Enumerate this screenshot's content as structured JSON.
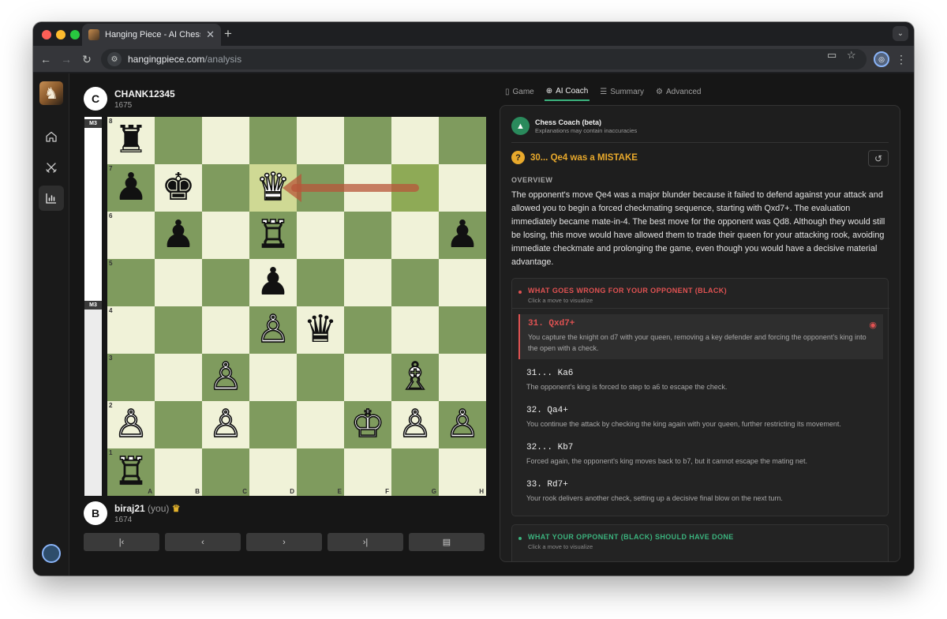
{
  "browser": {
    "tab_title": "Hanging Piece - AI Chess Coach",
    "url_host": "hangingpiece.com",
    "url_path": "/analysis"
  },
  "players": {
    "top": {
      "initial": "C",
      "name": "CHANK12345",
      "rating": "1675"
    },
    "bottom": {
      "initial": "B",
      "name": "biraj21",
      "you_label": "(you)",
      "rating": "1674"
    }
  },
  "eval_badges": {
    "top": "M3",
    "mid": "M3"
  },
  "board": {
    "ranks": [
      "8",
      "7",
      "6",
      "5",
      "4",
      "3",
      "2",
      "1"
    ],
    "files": [
      "A",
      "B",
      "C",
      "D",
      "E",
      "F",
      "G",
      "H"
    ],
    "rows": [
      [
        "♜",
        "",
        "",
        "",
        "",
        "",
        "",
        ""
      ],
      [
        "♟",
        "♚",
        "",
        "♛",
        "",
        "",
        "",
        ""
      ],
      [
        "",
        "♟",
        "",
        "♖",
        "",
        "",
        "",
        "♟"
      ],
      [
        "",
        "",
        "",
        "♟",
        "",
        "",
        "",
        ""
      ],
      [
        "",
        "",
        "",
        "♙",
        "♛",
        "",
        "",
        ""
      ],
      [
        "",
        "",
        "♙",
        "",
        "",
        "",
        "♗",
        ""
      ],
      [
        "♙",
        "",
        "♙",
        "",
        "",
        "♔",
        "♙",
        "♙"
      ],
      [
        "♖",
        "",
        "",
        "",
        "",
        "",
        "",
        ""
      ]
    ],
    "colors": [
      [
        "b",
        "",
        "",
        "",
        "",
        "",
        "",
        ""
      ],
      [
        "b",
        "b",
        "",
        "w",
        "",
        "",
        "",
        ""
      ],
      [
        "",
        "b",
        "",
        "w",
        "",
        "",
        "",
        "b"
      ],
      [
        "",
        "",
        "",
        "b",
        "",
        "",
        "",
        ""
      ],
      [
        "",
        "",
        "",
        "w",
        "b",
        "",
        "",
        ""
      ],
      [
        "",
        "",
        "w",
        "",
        "",
        "",
        "w",
        ""
      ],
      [
        "w",
        "",
        "w",
        "",
        "",
        "w",
        "w",
        "w"
      ],
      [
        "w",
        "",
        "",
        "",
        "",
        "",
        "",
        ""
      ]
    ],
    "last_move_squares": [
      "d7",
      "g7"
    ],
    "arrow": {
      "from": "g7",
      "to": "d7",
      "color": "#b8563a"
    }
  },
  "nav_buttons": [
    "first-icon",
    "prev-icon",
    "next-icon",
    "last-icon",
    "flip-icon"
  ],
  "panel": {
    "tabs": [
      {
        "label": "Game",
        "icon": "document-icon"
      },
      {
        "label": "AI Coach",
        "icon": "brain-icon"
      },
      {
        "label": "Summary",
        "icon": "list-icon"
      },
      {
        "label": "Advanced",
        "icon": "gear-icon"
      }
    ],
    "active_tab": "AI Coach",
    "coach_name": "Chess Coach (beta)",
    "coach_sub": "Explanations may contain inaccuracies",
    "mistake_icon": "?",
    "mistake_title": "30... Qe4 was a MISTAKE",
    "overview_label": "OVERVIEW",
    "overview_text": "The opponent's move Qe4 was a major blunder because it failed to defend against your attack and allowed you to begin a forced checkmating sequence, starting with Qxd7+. The evaluation immediately became mate-in-4. The best move for the opponent was Qd8. Although they would still be losing, this move would have allowed them to trade their queen for your attacking rook, avoiding immediate checkmate and prolonging the game, even though you would have a decisive material advantage.",
    "wrong_card": {
      "title": "WHAT GOES WRONG FOR YOUR OPPONENT (BLACK)",
      "subtitle": "Click a move to visualize",
      "color": "#e05252",
      "moves": [
        {
          "move": "31. Qxd7+",
          "desc": "You capture the knight on d7 with your queen, removing a key defender and forcing the opponent's king into the open with a check."
        },
        {
          "move": "31... Ka6",
          "desc": "The opponent's king is forced to step to a6 to escape the check."
        },
        {
          "move": "32. Qa4+",
          "desc": "You continue the attack by checking the king again with your queen, further restricting its movement."
        },
        {
          "move": "32... Kb7",
          "desc": "Forced again, the opponent's king moves back to b7, but it cannot escape the mating net."
        },
        {
          "move": "33. Rd7+",
          "desc": "Your rook delivers another check, setting up a decisive final blow on the next turn."
        }
      ]
    },
    "should_card": {
      "title": "WHAT YOUR OPPONENT (BLACK) SHOULD HAVE DONE",
      "subtitle": "Click a move to visualize",
      "color": "#3bb37e"
    }
  }
}
